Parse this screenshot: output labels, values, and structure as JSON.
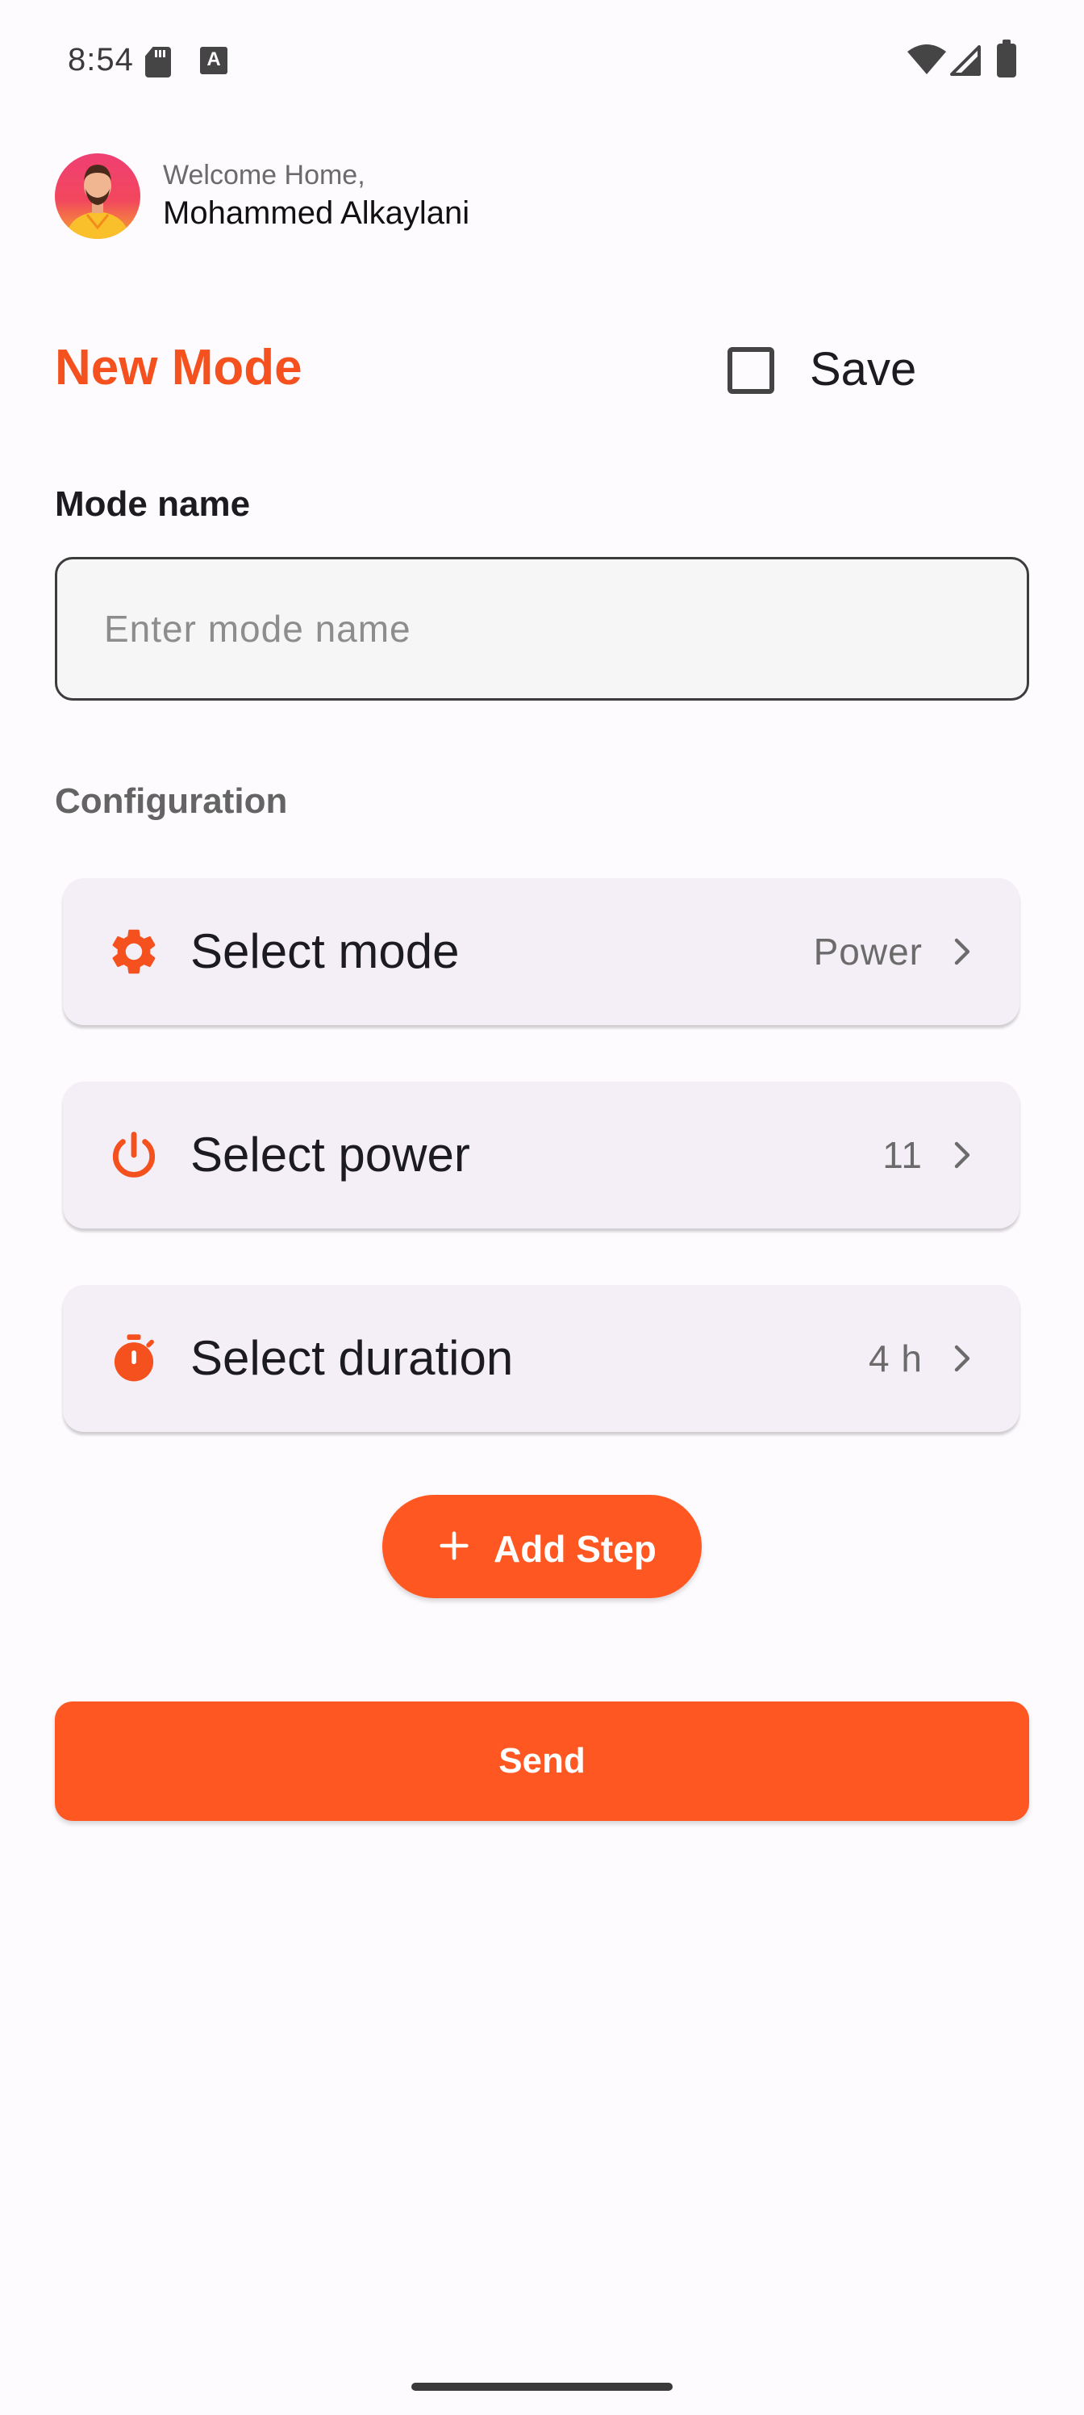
{
  "status_bar": {
    "time": "8:54",
    "icons": [
      "sd-card-icon",
      "text-a-icon",
      "wifi-icon",
      "cellular-signal-icon",
      "battery-icon"
    ]
  },
  "header": {
    "welcome": "Welcome Home,",
    "user_name": "Mohammed Alkaylani"
  },
  "page": {
    "title": "New Mode",
    "save_label": "Save",
    "save_checked": false
  },
  "form": {
    "mode_name_label": "Mode name",
    "mode_name_placeholder": "Enter mode name",
    "mode_name_value": "",
    "section_label": "Configuration",
    "items": [
      {
        "icon": "gear-icon",
        "label": "Select mode",
        "value": "Power"
      },
      {
        "icon": "power-icon",
        "label": "Select power",
        "value": "11"
      },
      {
        "icon": "stopwatch-icon",
        "label": "Select duration",
        "value": "4 h"
      }
    ],
    "add_step_label": "Add Step",
    "send_label": "Send"
  },
  "colors": {
    "accent": "#ff5722",
    "title": "#f4511e",
    "card_bg": "#f4eff7",
    "page_bg": "#fefbff"
  }
}
